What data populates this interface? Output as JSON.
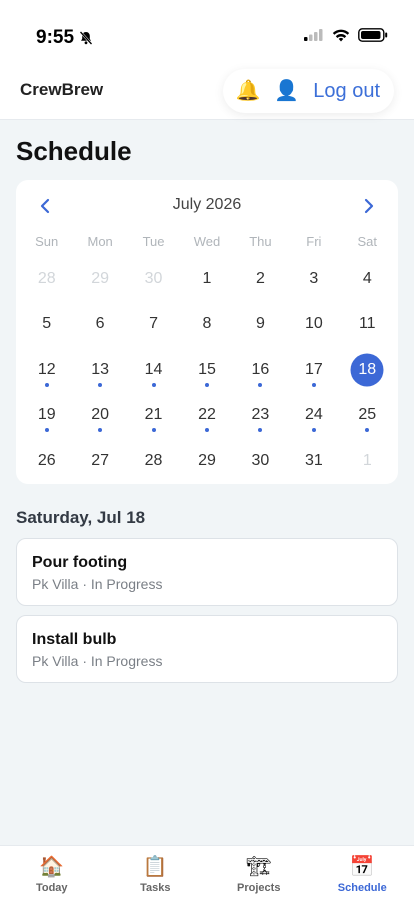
{
  "status_bar": {
    "time": "9:55"
  },
  "header": {
    "brand": "CrewBrew",
    "logout_label": "Log out",
    "bell_icon": "🔔",
    "user_icon": "👤"
  },
  "page": {
    "title": "Schedule"
  },
  "calendar": {
    "month_label": "July 2026",
    "weekdays": [
      "Sun",
      "Mon",
      "Tue",
      "Wed",
      "Thu",
      "Fri",
      "Sat"
    ],
    "selected_day": "18",
    "accent_color": "#3c68d6",
    "days": [
      {
        "label": "28",
        "muted": true,
        "dot": false
      },
      {
        "label": "29",
        "muted": true,
        "dot": false
      },
      {
        "label": "30",
        "muted": true,
        "dot": false
      },
      {
        "label": "1",
        "muted": false,
        "dot": false
      },
      {
        "label": "2",
        "muted": false,
        "dot": false
      },
      {
        "label": "3",
        "muted": false,
        "dot": false
      },
      {
        "label": "4",
        "muted": false,
        "dot": false
      },
      {
        "label": "5",
        "muted": false,
        "dot": false
      },
      {
        "label": "6",
        "muted": false,
        "dot": false
      },
      {
        "label": "7",
        "muted": false,
        "dot": false
      },
      {
        "label": "8",
        "muted": false,
        "dot": false
      },
      {
        "label": "9",
        "muted": false,
        "dot": false
      },
      {
        "label": "10",
        "muted": false,
        "dot": false
      },
      {
        "label": "11",
        "muted": false,
        "dot": false
      },
      {
        "label": "12",
        "muted": false,
        "dot": true
      },
      {
        "label": "13",
        "muted": false,
        "dot": true
      },
      {
        "label": "14",
        "muted": false,
        "dot": true
      },
      {
        "label": "15",
        "muted": false,
        "dot": true
      },
      {
        "label": "16",
        "muted": false,
        "dot": true
      },
      {
        "label": "17",
        "muted": false,
        "dot": true
      },
      {
        "label": "18",
        "muted": false,
        "dot": false,
        "selected": true
      },
      {
        "label": "19",
        "muted": false,
        "dot": true
      },
      {
        "label": "20",
        "muted": false,
        "dot": true
      },
      {
        "label": "21",
        "muted": false,
        "dot": true
      },
      {
        "label": "22",
        "muted": false,
        "dot": true
      },
      {
        "label": "23",
        "muted": false,
        "dot": true
      },
      {
        "label": "24",
        "muted": false,
        "dot": true
      },
      {
        "label": "25",
        "muted": false,
        "dot": true
      },
      {
        "label": "26",
        "muted": false,
        "dot": false
      },
      {
        "label": "27",
        "muted": false,
        "dot": false
      },
      {
        "label": "28",
        "muted": false,
        "dot": false
      },
      {
        "label": "29",
        "muted": false,
        "dot": false
      },
      {
        "label": "30",
        "muted": false,
        "dot": false
      },
      {
        "label": "31",
        "muted": false,
        "dot": false
      },
      {
        "label": "1",
        "muted": true,
        "dot": false
      }
    ]
  },
  "agenda": {
    "date_heading": "Saturday, Jul 18",
    "tasks": [
      {
        "title": "Pour footing",
        "subtitle": "Pk Villa · In Progress"
      },
      {
        "title": "Install bulb",
        "subtitle": "Pk Villa · In Progress"
      }
    ]
  },
  "tabbar": {
    "tabs": [
      {
        "label": "Today",
        "icon": "🏠",
        "active": false
      },
      {
        "label": "Tasks",
        "icon": "📋",
        "active": false
      },
      {
        "label": "Projects",
        "icon": "🏗",
        "active": false
      },
      {
        "label": "Schedule",
        "icon": "📅",
        "active": true
      }
    ]
  }
}
